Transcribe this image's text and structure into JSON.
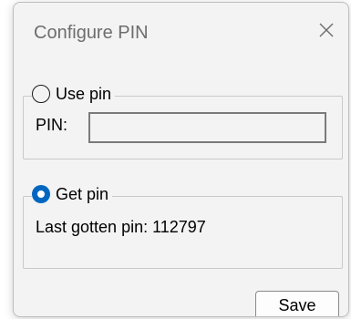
{
  "window": {
    "title": "Configure PIN",
    "close_icon": "close-icon"
  },
  "use_pin": {
    "label": "Use pin",
    "selected": false,
    "pin_label": "PIN:",
    "pin_value": ""
  },
  "get_pin": {
    "label": "Get pin",
    "selected": true,
    "last_pin_text": "Last gotten pin: 112797"
  },
  "buttons": {
    "save_label": "Save"
  },
  "colors": {
    "accent": "#0067c0",
    "dialog_bg": "#f3f3f3"
  }
}
